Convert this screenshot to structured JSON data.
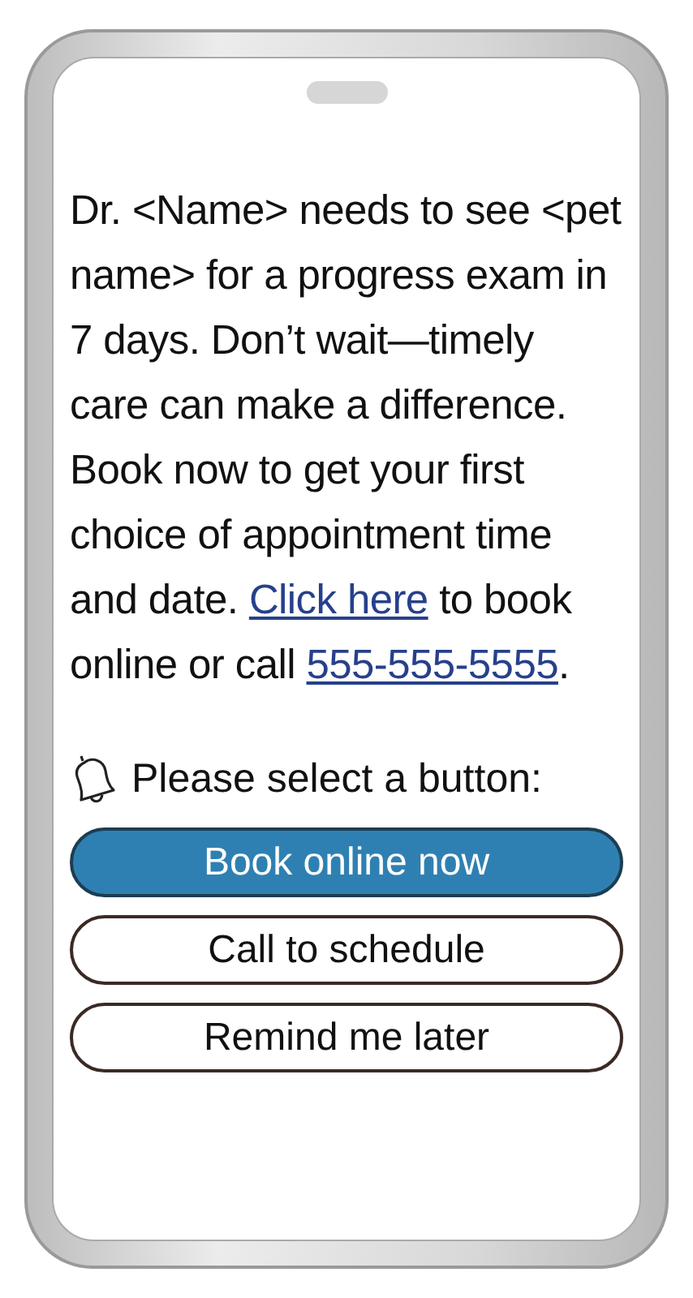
{
  "message": [
    {
      "kind": "text",
      "text": "Dr. <Name> needs to see <pet name> for a progress exam in 7 days. Don’t wait—timely care can make a difference. Book now to get your first choice of appointment time and date. "
    },
    {
      "kind": "link",
      "text": "Click here"
    },
    {
      "kind": "text",
      "text": " to book online or call "
    },
    {
      "kind": "link",
      "text": "555-555-5555"
    },
    {
      "kind": "text",
      "text": "."
    }
  ],
  "prompt": "Please select a button:",
  "buttons": [
    {
      "label": "Book online now",
      "selected": true
    },
    {
      "label": "Call to schedule",
      "selected": false
    },
    {
      "label": "Remind me later",
      "selected": false
    }
  ]
}
